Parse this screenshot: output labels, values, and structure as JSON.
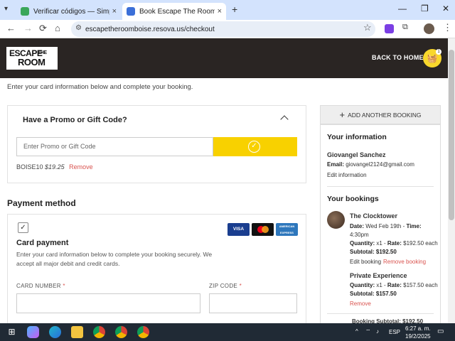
{
  "browser": {
    "tabs": [
      {
        "title": "Verificar códigos — SimplyCodes",
        "close": "×"
      },
      {
        "title": "Book Escape The Room Boise",
        "close": "×"
      }
    ],
    "new_tab": "+",
    "url": "escapetheroomboise.resova.us/checkout"
  },
  "site": {
    "logo_line1": "ESCAPE",
    "logo_the": "THE",
    "logo_line2": "ROOM",
    "back_home": "BACK TO HOME",
    "cart_count": "1"
  },
  "checkout": {
    "intro": "Enter your card information below and complete your booking.",
    "promo": {
      "title": "Have a Promo or Gift Code?",
      "placeholder": "Enter Promo or Gift Code",
      "applied_code": "BOISE10",
      "applied_amount": "$19.25",
      "remove": "Remove"
    },
    "payment": {
      "title": "Payment method",
      "cards": [
        "VISA",
        "",
        "AMERICAN EXPRESS"
      ],
      "card_title": "Card payment",
      "description": "Enter your card information below to complete your booking securely. We accept all major debit and credit cards.",
      "card_number_label": "CARD NUMBER",
      "zip_label": "ZIP CODE",
      "required_mark": "*"
    }
  },
  "sidebar": {
    "add_booking": "ADD ANOTHER BOOKING",
    "your_info_title": "Your information",
    "name": "Giovangel Sanchez",
    "email_label": "Email:",
    "email": "giovangel2124@gmail.com",
    "edit_info": "Edit information",
    "bookings_title": "Your bookings",
    "bookings": [
      {
        "name": "The Clocktower",
        "date_label": "Date:",
        "date": "Wed Feb 19th",
        "time_label": "Time:",
        "time": "4:30pm",
        "qty_label": "Quantity:",
        "qty": "x1",
        "rate_label": "Rate:",
        "rate": "$192.50 each",
        "subtotal_label": "Subtotal:",
        "subtotal": "$192.50",
        "edit": "Edit booking",
        "remove": "Remove booking"
      },
      {
        "name": "Private Experience",
        "qty_label": "Quantity:",
        "qty": "x1",
        "rate_label": "Rate:",
        "rate": "$157.50 each",
        "subtotal_label": "Subtotal:",
        "subtotal": "$157.50",
        "remove": "Remove"
      }
    ],
    "booking_subtotal_partial": "Booking Subtotal: $192.50"
  },
  "taskbar": {
    "lang": "ESP",
    "time": "6:27 a. m.",
    "date": "19/2/2025"
  },
  "colors": {
    "header_bg": "#2a2523",
    "accent_yellow": "#f8d100",
    "remove_red": "#d9534f"
  }
}
